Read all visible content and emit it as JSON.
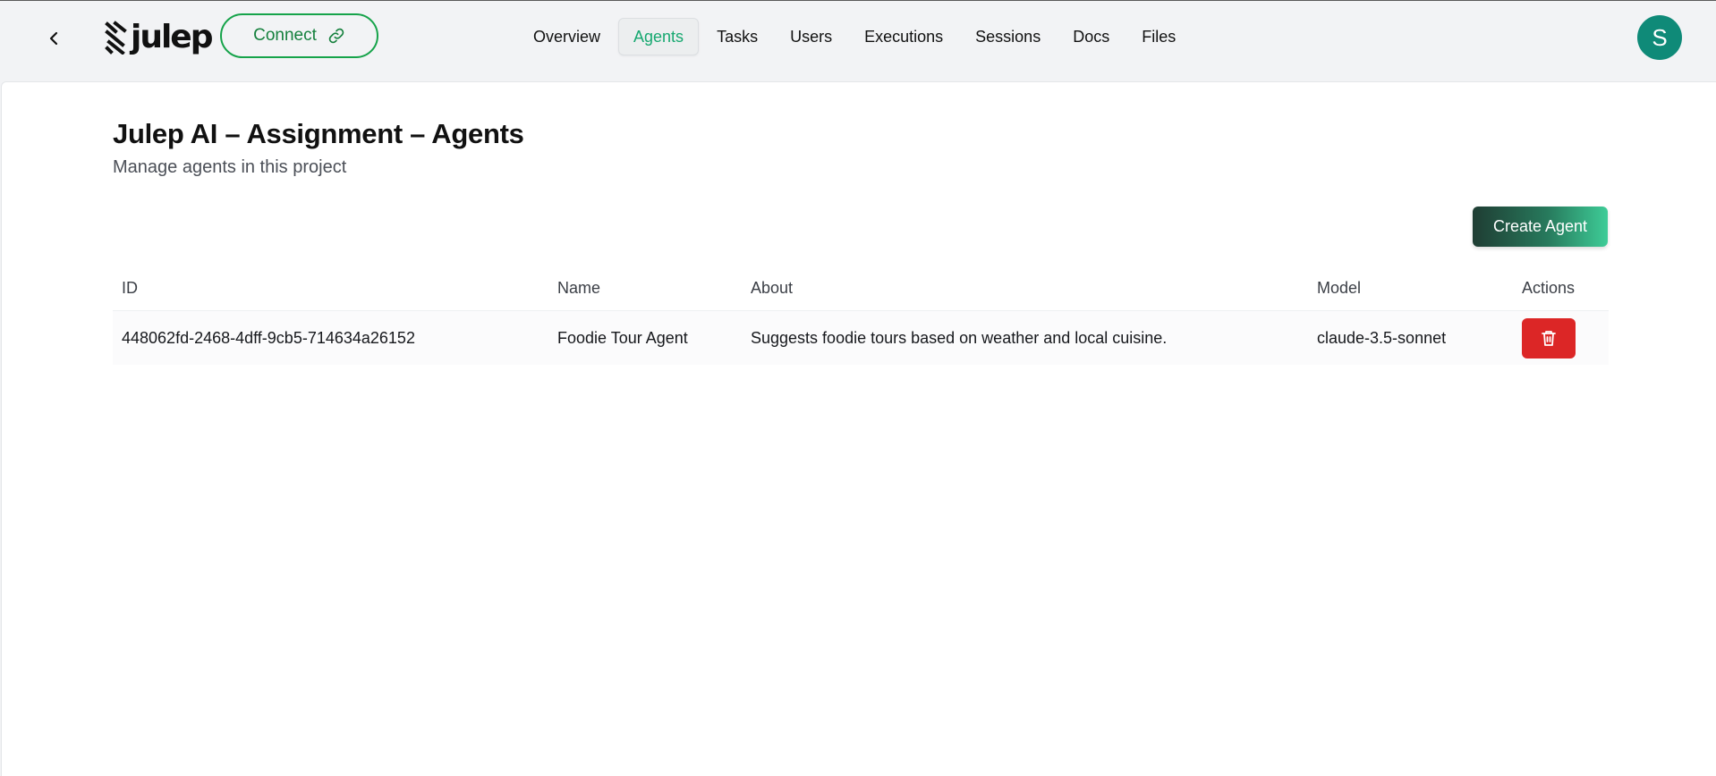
{
  "header": {
    "logo_text": "julep",
    "connect_label": "Connect",
    "nav": [
      {
        "label": "Overview",
        "active": false
      },
      {
        "label": "Agents",
        "active": true
      },
      {
        "label": "Tasks",
        "active": false
      },
      {
        "label": "Users",
        "active": false
      },
      {
        "label": "Executions",
        "active": false
      },
      {
        "label": "Sessions",
        "active": false
      },
      {
        "label": "Docs",
        "active": false
      },
      {
        "label": "Files",
        "active": false
      }
    ],
    "avatar_initial": "S"
  },
  "page": {
    "title": "Julep AI – Assignment – Agents",
    "subtitle": "Manage agents in this project",
    "create_button_label": "Create Agent"
  },
  "table": {
    "columns": [
      "ID",
      "Name",
      "About",
      "Model",
      "Actions"
    ],
    "rows": [
      {
        "id": "448062fd-2468-4dff-9cb5-714634a26152",
        "name": "Foodie Tour Agent",
        "about": "Suggests foodie tours based on weather and local cuisine.",
        "model": "claude-3.5-sonnet"
      }
    ]
  },
  "icons": {
    "back": "chevron-left-icon",
    "connect": "link-icon",
    "delete": "trash-icon",
    "logo": "julep-logo-mark"
  },
  "colors": {
    "accent_green": "#16a34a",
    "active_nav": "#16a870",
    "avatar_bg": "#0f8a78",
    "delete_red": "#dc2626"
  }
}
